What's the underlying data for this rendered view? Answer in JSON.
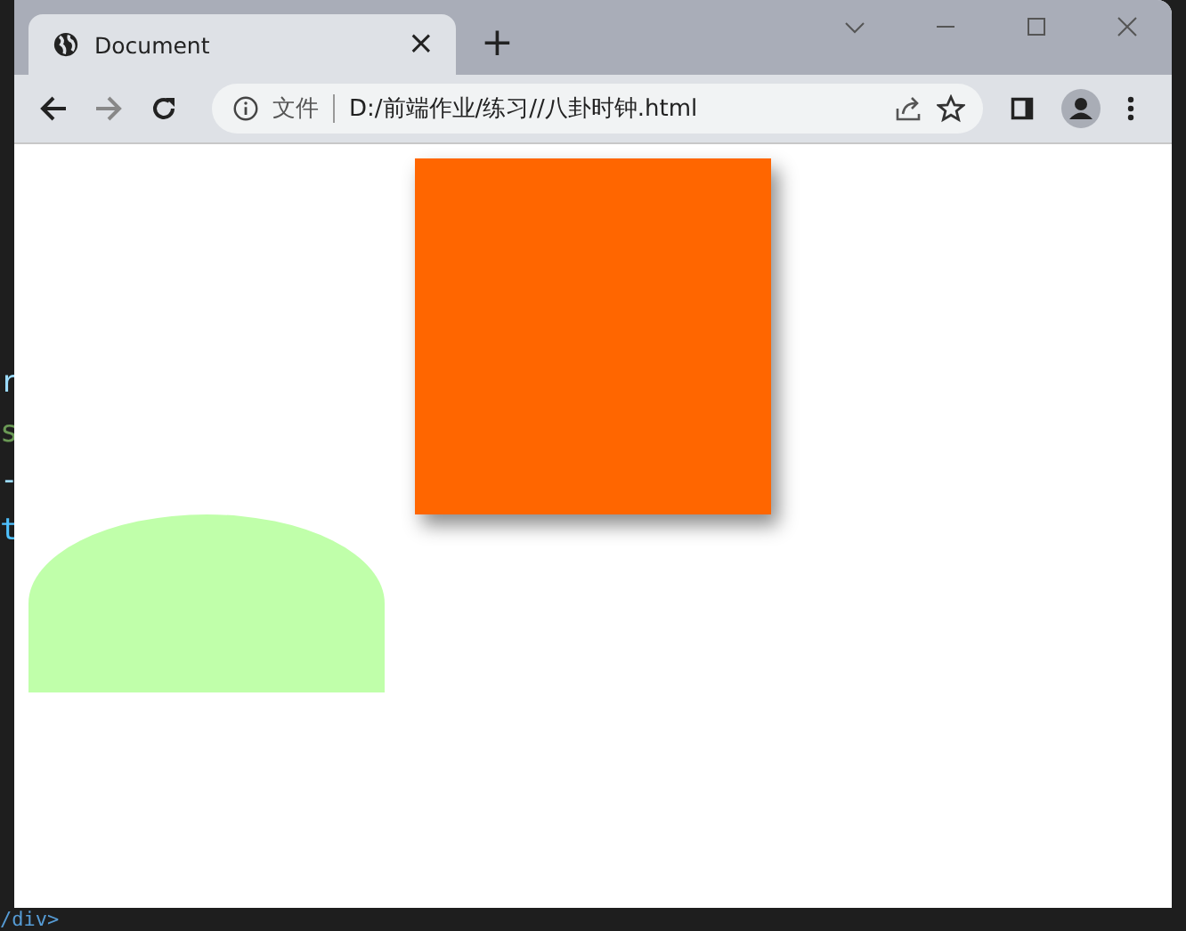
{
  "editor_fragments": [
    {
      "text": "r",
      "color": "#9cdcfe"
    },
    {
      "text": "s",
      "color": "#6a9955"
    },
    {
      "text": "-",
      "color": "#9cdcfe"
    },
    {
      "text": "t",
      "color": "#4fc1ff"
    }
  ],
  "editor_bottom": "/div>",
  "browser": {
    "tab": {
      "title": "Document",
      "close": "×"
    },
    "new_tab": "+",
    "address": {
      "security_label": "文件",
      "url": "D:/前端作业/练习//八卦时钟.html"
    }
  },
  "shapes": [
    {
      "kind": "square",
      "color": "#ff6600"
    },
    {
      "kind": "dome",
      "color": "#c0ffaa"
    }
  ]
}
